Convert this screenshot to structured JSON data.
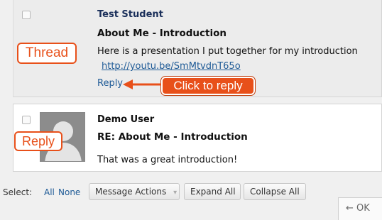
{
  "thread": {
    "author": "Test Student",
    "subject": "About Me - Introduction",
    "body": "Here is a presentation I put together for my introduction",
    "link": "http://youtu.be/SmMtvdnT65o",
    "reply_label": "Reply"
  },
  "reply": {
    "author": "Demo User",
    "subject": "RE: About Me - Introduction",
    "body": "That was a great introduction!"
  },
  "annotations": {
    "thread_label": "Thread",
    "click_to_reply": "Click to reply",
    "reply_label": "Reply",
    "accent_color": "#e8501a"
  },
  "toolbar": {
    "select_label": "Select:",
    "all": "All",
    "none": "None",
    "message_actions": "Message Actions",
    "expand_all": "Expand All",
    "collapse_all": "Collapse All",
    "ok": "← OK"
  },
  "icons": {
    "avatar": "default-user-avatar-icon",
    "dropdown": "chevron-down-icon",
    "arrow": "arrow-left-icon"
  },
  "colors": {
    "link": "#1e5a96",
    "author": "#1a2f5a"
  }
}
